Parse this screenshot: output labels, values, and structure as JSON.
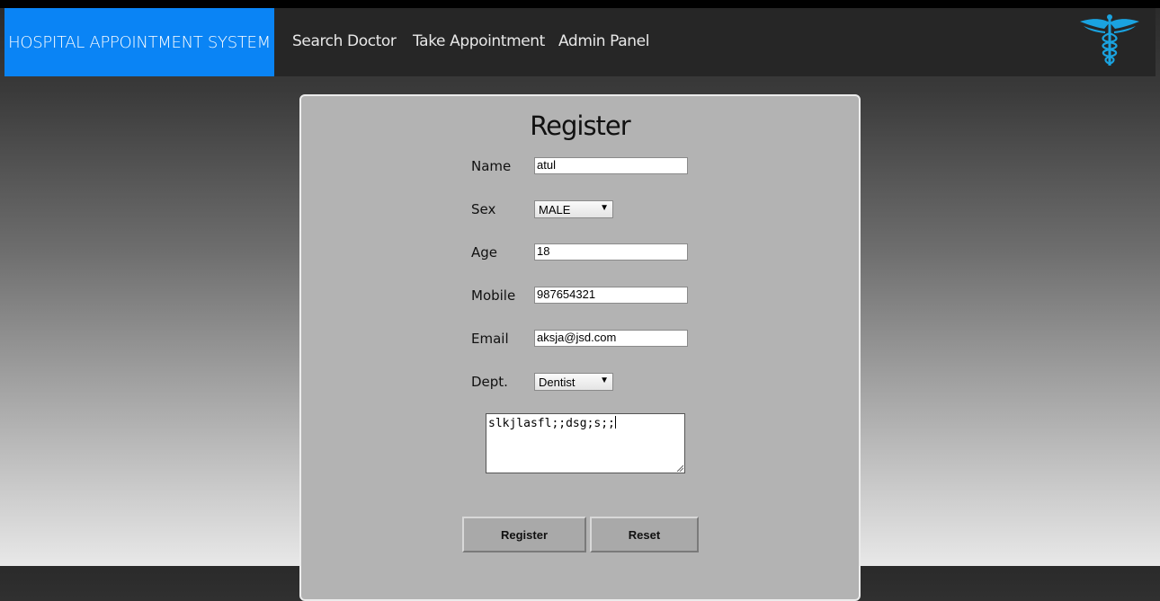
{
  "nav": {
    "brand": "HOSPITAL APPOINTMENT SYSTEM",
    "links": [
      "Search Doctor",
      "Take Appointment",
      "Admin Panel"
    ],
    "logo_icon": "caduceus-icon",
    "brand_color": "#0a84f5",
    "logo_color": "#1aa3e0"
  },
  "form": {
    "title": "Register",
    "fields": [
      {
        "label": "Name",
        "value": "atul"
      },
      {
        "label": "Sex",
        "value": "MALE"
      },
      {
        "label": "Age",
        "value": "18"
      },
      {
        "label": "Mobile",
        "value": "987654321"
      },
      {
        "label": "Email",
        "value": "aksja@jsd.com"
      },
      {
        "label": "Dept.",
        "value": "Dentist"
      }
    ],
    "textarea_value": "slkjlasfl;;dsg;s;;",
    "buttons": {
      "register": "Register",
      "reset": "Reset"
    }
  }
}
